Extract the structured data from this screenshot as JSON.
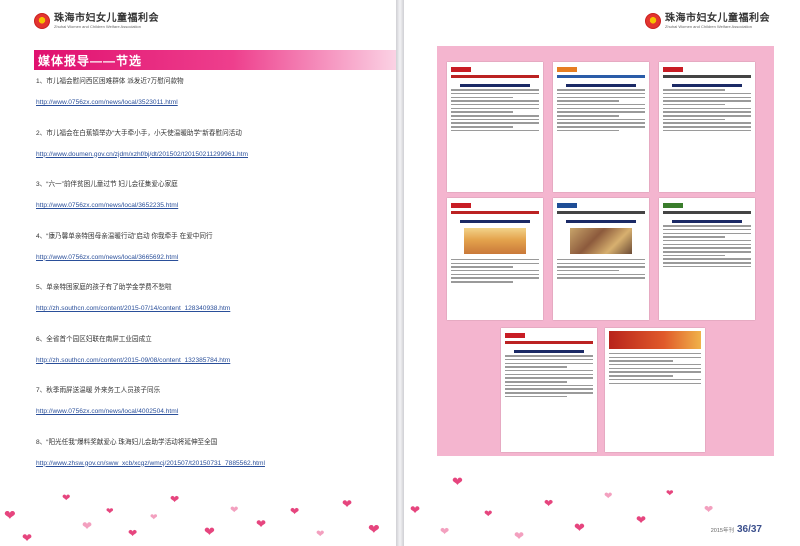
{
  "org": {
    "name_cn": "珠海市妇女儿童福利会",
    "name_en": "Zhuhai Women and Children Welfare Association"
  },
  "section_title": "媒体报导——节选",
  "news": [
    {
      "title": "1、市儿福会慰问西区困难群体 派发近7万慰问款物",
      "url": "http://www.0756zx.com/news/local/3523011.html"
    },
    {
      "title": "2、市儿福会在白蕉镇举办“大手牵小手，小天使温暖助学”新春慰问活动",
      "url": "http://www.doumen.gov.cn/zjdm/xzhf/bj/dt/201502/t20150211299961.htm"
    },
    {
      "title": "3、“六一”前伴贫困儿童过节 妇儿会征集爱心家庭",
      "url": "http://www.0756zx.com/news/local/3652235.html"
    },
    {
      "title": "4、“康乃馨单亲特困母亲温暖行动”启动 你我牵手 在爱中同行",
      "url": "http://www.0756zx.com/news/local/3665692.html"
    },
    {
      "title": "5、单亲特困家庭的孩子有了助学金学费不愁啦",
      "url": "http://zh.southcn.com/content/2015-07/14/content_128340938.htm"
    },
    {
      "title": "6、全省首个园区妇联在南屏工业园成立",
      "url": "http://zh.southcn.com/content/2015-09/08/content_132385784.htm"
    },
    {
      "title": "7、秋季雨屏送温暖 外来务工人员孩子同乐",
      "url": "http://www.0756zx.com/news/local/4002504.html"
    },
    {
      "title": "8、“阳光任我”爆料奖献爱心 珠海妇儿会助学活动将延伸至全国",
      "url": "http://www.zhsw.gov.cn/sww_xcb/xcgz/wmcj/201507/t20150731_7885562.html"
    }
  ],
  "footer": {
    "issue": "2015年刊",
    "pages": "36/37"
  },
  "colors": {
    "accent": "#e0106f",
    "panel": "#f4b5cf",
    "link": "#2a4f9a"
  }
}
